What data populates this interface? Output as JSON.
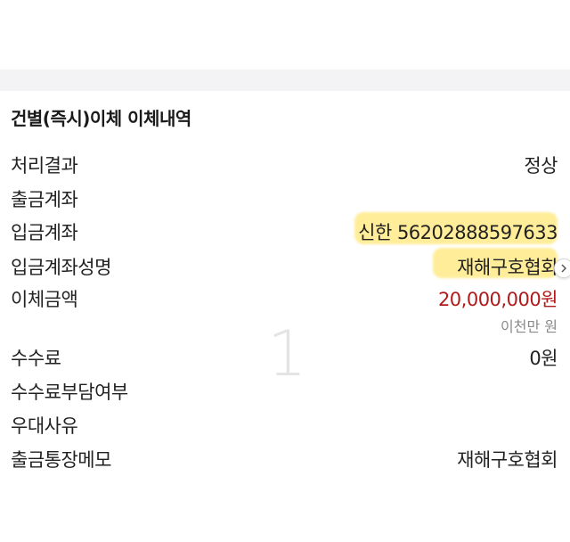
{
  "title": "건별(즉시)이체 이체내역",
  "rows": [
    {
      "label": "처리결과",
      "value": "정상"
    },
    {
      "label": "출금계좌",
      "value": ""
    },
    {
      "label": "입금계좌",
      "value": "신한 56202888597633"
    },
    {
      "label": "입금계좌성명",
      "value": "재해구호협회"
    },
    {
      "label": "이체금액",
      "value": "20,000,000원",
      "sub": "이천만 원"
    },
    {
      "label": "수수료",
      "value": "0원"
    },
    {
      "label": "수수료부담여부",
      "value": ""
    },
    {
      "label": "우대사유",
      "value": ""
    },
    {
      "label": "출금통장메모",
      "value": "재해구호협회"
    }
  ],
  "watermark": "1",
  "icons": {
    "next": "chevron-right-icon"
  },
  "colors": {
    "amount": "#b01a1a",
    "highlight": "#ffe25a"
  }
}
